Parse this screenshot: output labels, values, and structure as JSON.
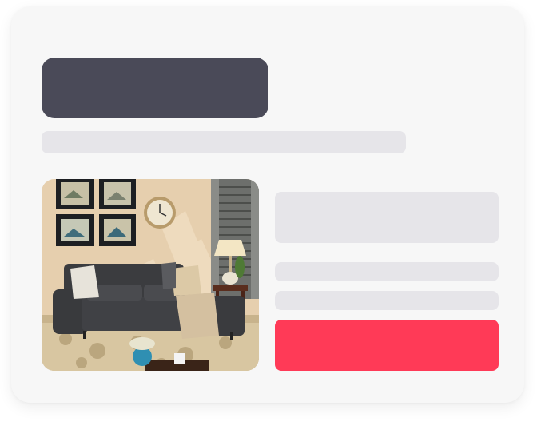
{
  "card": {
    "title": "",
    "subtitle": "",
    "product_image": {
      "icon": "product-photo-sofa",
      "subject": ""
    },
    "info": {
      "heading": "",
      "line1": "",
      "line2": ""
    },
    "cta_label": ""
  },
  "colors": {
    "title_block": "#4a4a58",
    "placeholder": "#e6e5e9",
    "cta": "#ff3a57",
    "card_bg": "#f7f7f7"
  }
}
